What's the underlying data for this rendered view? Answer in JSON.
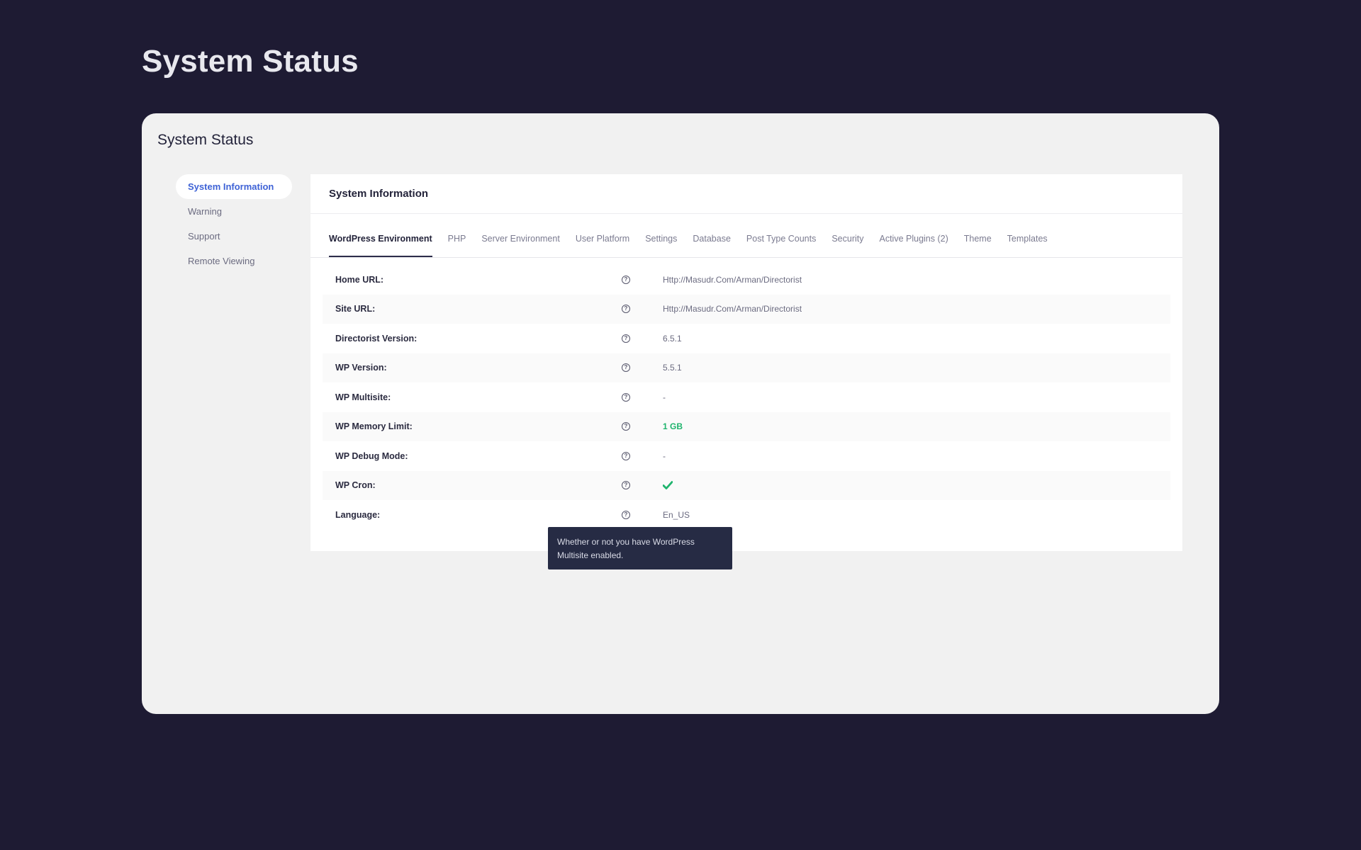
{
  "page_title": "System Status",
  "card_title": "System Status",
  "sidebar": {
    "items": [
      {
        "label": "System Information",
        "active": true
      },
      {
        "label": "Warning"
      },
      {
        "label": "Support"
      },
      {
        "label": "Remote Viewing"
      }
    ]
  },
  "panel": {
    "title": "System Information",
    "tabs": [
      {
        "label": "WordPress Environment",
        "active": true
      },
      {
        "label": "PHP"
      },
      {
        "label": "Server Environment"
      },
      {
        "label": "User Platform"
      },
      {
        "label": "Settings"
      },
      {
        "label": "Database"
      },
      {
        "label": "Post Type Counts"
      },
      {
        "label": "Security"
      },
      {
        "label": "Active Plugins (2)"
      },
      {
        "label": "Theme"
      },
      {
        "label": "Templates"
      }
    ],
    "rows": [
      {
        "label": "Home URL:",
        "value": "Http://Masudr.Com/Arman/Directorist"
      },
      {
        "label": "Site URL:",
        "value": "Http://Masudr.Com/Arman/Directorist"
      },
      {
        "label": "Directorist Version:",
        "value": "6.5.1"
      },
      {
        "label": "WP Version:",
        "value": "5.5.1"
      },
      {
        "label": "WP Multisite:",
        "value": "-"
      },
      {
        "label": "WP Memory Limit:",
        "value": "1 GB",
        "status": "green"
      },
      {
        "label": "WP Debug Mode:",
        "value": "-"
      },
      {
        "label": "WP Cron:",
        "value": "",
        "icon": "checkmark-icon"
      },
      {
        "label": "Language:",
        "value": "En_US"
      }
    ],
    "help_icon": "question-circle-icon"
  },
  "tooltip": {
    "text": "Whether or not you have WordPress Multisite enabled."
  },
  "colors": {
    "background": "#1e1b33",
    "accent": "#3e62d6",
    "success": "#1fb46d",
    "tooltip_bg": "#262b44"
  }
}
